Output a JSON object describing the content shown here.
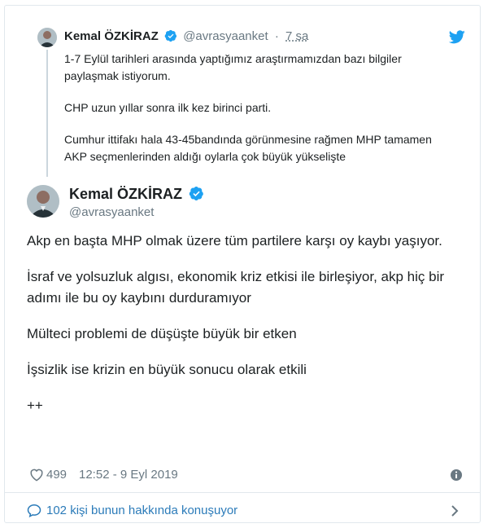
{
  "parent_tweet": {
    "name": "Kemal ÖZKİRAZ",
    "handle": "@avrasyaanket",
    "time": "7 sa",
    "paragraphs": [
      "1-7 Eylül tarihleri arasında yaptığımız araştırmamızdan bazı bilgiler paylaşmak istiyorum.",
      "CHP uzun yıllar sonra ilk kez birinci parti.",
      "Cumhur ittifakı hala 43-45bandında görünmesine rağmen MHP tamamen AKP seçmenlerinden aldığı oylarla çok büyük yükselişte"
    ]
  },
  "main_tweet": {
    "name": "Kemal ÖZKİRAZ",
    "handle": "@avrasyaanket",
    "paragraphs": [
      "Akp en başta MHP olmak üzere tüm partilere karşı oy kaybı yaşıyor.",
      "İsraf ve yolsuzluk algısı, ekonomik kriz etkisi ile birleşiyor, akp hiç bir adımı ile bu oy kaybını durduramıyor",
      "Mülteci problemi de düşüşte büyük bir etken",
      "İşsizlik ise krizin en büyük sonucu olarak etkili",
      "++"
    ],
    "likes": "499",
    "timestamp": "12:52 - 9 Eyl 2019"
  },
  "conversation": {
    "label": "102 kişi bunun hakkında konuşuyor"
  },
  "icons": [
    "verified-badge-icon",
    "twitter-bird-icon",
    "heart-icon",
    "info-icon",
    "speech-bubble-icon",
    "chevron-right-icon"
  ],
  "colors": {
    "twitter_blue": "#1da1f2",
    "link_blue": "#2b7bb9",
    "muted_text": "#697882",
    "body_text": "#1c2022"
  }
}
